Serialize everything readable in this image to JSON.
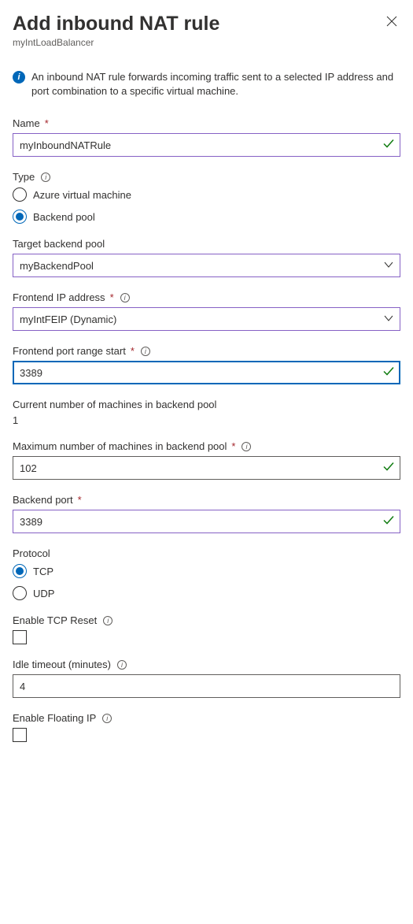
{
  "header": {
    "title": "Add inbound NAT rule",
    "subtitle": "myIntLoadBalancer"
  },
  "info": {
    "text": "An inbound NAT rule forwards incoming traffic sent to a selected IP address and port combination to a specific virtual machine."
  },
  "fields": {
    "name": {
      "label": "Name",
      "value": "myInboundNATRule"
    },
    "type": {
      "label": "Type",
      "options": {
        "vm": "Azure virtual machine",
        "pool": "Backend pool"
      }
    },
    "targetPool": {
      "label": "Target backend pool",
      "value": "myBackendPool"
    },
    "frontendIp": {
      "label": "Frontend IP address",
      "value": "myIntFEIP (Dynamic)"
    },
    "portStart": {
      "label": "Frontend port range start",
      "value": "3389"
    },
    "currentMachines": {
      "label": "Current number of machines in backend pool",
      "value": "1"
    },
    "maxMachines": {
      "label": "Maximum number of machines in backend pool",
      "value": "102"
    },
    "backendPort": {
      "label": "Backend port",
      "value": "3389"
    },
    "protocol": {
      "label": "Protocol",
      "options": {
        "tcp": "TCP",
        "udp": "UDP"
      }
    },
    "tcpReset": {
      "label": "Enable TCP Reset"
    },
    "idleTimeout": {
      "label": "Idle timeout (minutes)",
      "value": "4"
    },
    "floatingIp": {
      "label": "Enable Floating IP"
    }
  }
}
